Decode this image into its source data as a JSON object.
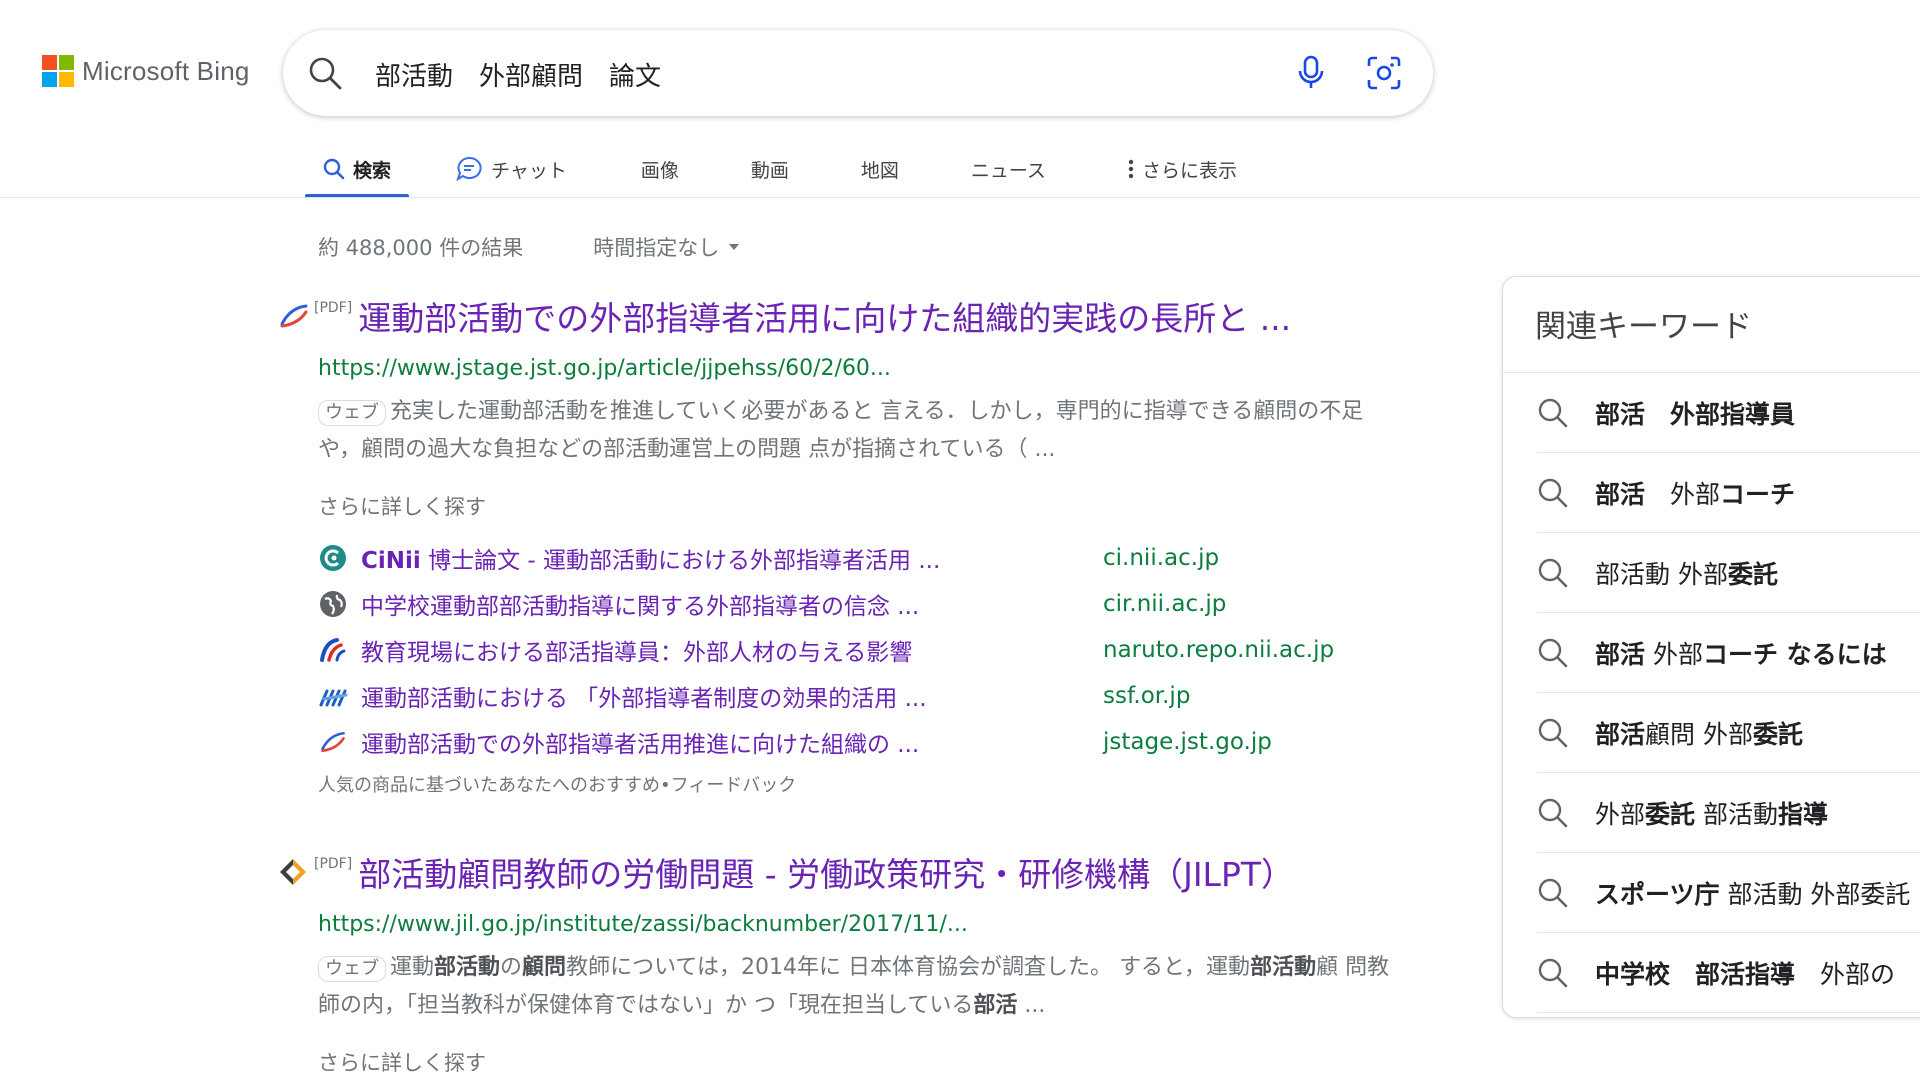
{
  "header": {
    "logo_text": "Microsoft Bing",
    "logo_colors": [
      "#f25022",
      "#7fba00",
      "#00a4ef",
      "#ffb900"
    ],
    "search_value": "部活動　外部顧問　論文"
  },
  "tabs": [
    {
      "label": "検索",
      "icon": "search-icon",
      "active": true
    },
    {
      "label": "チャット",
      "icon": "chat-icon"
    },
    {
      "label": "画像"
    },
    {
      "label": "動画"
    },
    {
      "label": "地図"
    },
    {
      "label": "ニュース"
    },
    {
      "label": "さらに表示",
      "icon": "more-vertical-icon"
    }
  ],
  "results_meta": {
    "count": "約 488,000 件の結果",
    "time_filter": "時間指定なし"
  },
  "results": [
    {
      "pdf_tag": "[PDF]",
      "title": "運動部活動での外部指導者活用に向けた組織的実践の長所と ...",
      "url": "https://www.jstage.jst.go.jp/article/jjpehss/60/2/60...",
      "tag": "ウェブ",
      "snippet": "充実した運動部活動を推進していく必要があると 言える．しかし，専門的に指導できる顧問の不足 や，顧問の過大な負担などの部活動運営上の問題 点が指摘されている（ ...",
      "more_label": "さらに詳しく探す",
      "deep_links": [
        {
          "prefix": "CiNii",
          "title": " 博士論文 - 運動部活動における外部指導者活用 ...",
          "domain": "ci.nii.ac.jp",
          "icon": "cinii-icon"
        },
        {
          "prefix": "",
          "title": "中学校運動部部活動指導に関する外部指導者の信念 ...",
          "domain": "cir.nii.ac.jp",
          "icon": "globe-icon"
        },
        {
          "prefix": "",
          "title": "教育現場における部活指導員：外部人材の与える影響",
          "domain": "naruto.repo.nii.ac.jp",
          "icon": "repository-icon"
        },
        {
          "prefix": "",
          "title": "運動部活動における 「外部指導者制度の効果的活用 ...",
          "domain": "ssf.or.jp",
          "icon": "ssf-icon"
        },
        {
          "prefix": "",
          "title": "運動部活動での外部指導者活用推進に向けた組織の ...",
          "domain": "jstage.jst.go.jp",
          "icon": "jstage-icon"
        }
      ],
      "feedback": "人気の商品に基づいたあなたへのおすすめ•フィードバック"
    },
    {
      "pdf_tag": "[PDF]",
      "title": "部活動顧問教師の労働問題 - 労働政策研究・研修機構（JILPT）",
      "url": "https://www.jil.go.jp/institute/zassi/backnumber/2017/11/...",
      "tag": "ウェブ",
      "snippet_parts": [
        {
          "t": "運動"
        },
        {
          "t": "部活動",
          "b": true
        },
        {
          "t": "の"
        },
        {
          "t": "顧問",
          "b": true
        },
        {
          "t": "教師については，2014年に 日本体育協会が調査した。 すると，運動"
        },
        {
          "t": "部活動",
          "b": true
        },
        {
          "t": "顧 問教師の内，「担当教科が保健体育ではない」か つ「現在担当している"
        },
        {
          "t": "部活",
          "b": true
        },
        {
          "t": " ..."
        }
      ],
      "more_label": "さらに詳しく探す"
    }
  ],
  "related": {
    "title": "関連キーワード",
    "items": [
      [
        {
          "t": "部活",
          "b": true
        },
        {
          "t": "　外部指導員",
          "b": true
        }
      ],
      [
        {
          "t": "部活",
          "b": true
        },
        {
          "t": "　外部"
        },
        {
          "t": "コーチ",
          "b": true
        }
      ],
      [
        {
          "t": "部活動 外部"
        },
        {
          "t": "委託",
          "b": true
        }
      ],
      [
        {
          "t": "部活",
          "b": true
        },
        {
          "t": " 外部"
        },
        {
          "t": "コーチ なるには",
          "b": true
        }
      ],
      [
        {
          "t": "部活",
          "b": true
        },
        {
          "t": "顧問 外部"
        },
        {
          "t": "委託",
          "b": true
        }
      ],
      [
        {
          "t": "外部"
        },
        {
          "t": "委託",
          "b": true
        },
        {
          "t": " 部活動"
        },
        {
          "t": "指導",
          "b": true
        }
      ],
      [
        {
          "t": "スポーツ庁",
          "b": true
        },
        {
          "t": " 部活動 外部委託"
        }
      ],
      [
        {
          "t": "中学校",
          "b": true
        },
        {
          "t": "　"
        },
        {
          "t": "部活指導",
          "b": true
        },
        {
          "t": "　外部の"
        }
      ]
    ]
  }
}
